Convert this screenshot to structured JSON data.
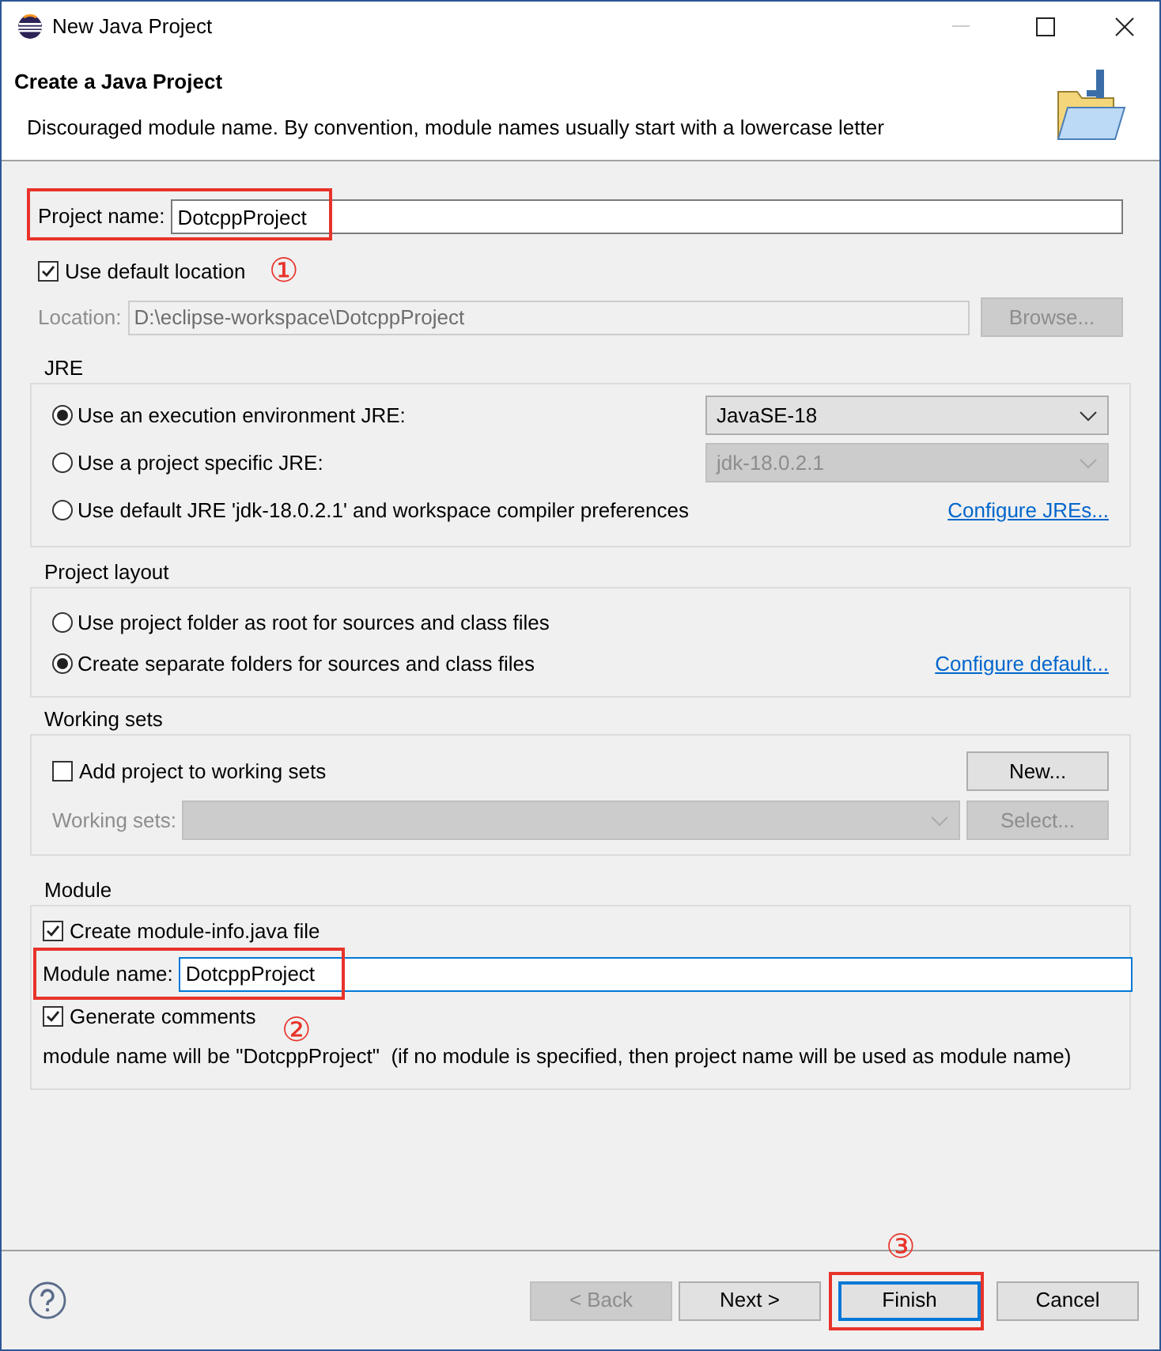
{
  "window": {
    "title": "New Java Project"
  },
  "header": {
    "title": "Create a Java Project",
    "message": "Discouraged module name. By convention, module names usually start with a lowercase letter"
  },
  "project_name": {
    "label": "Project name:",
    "value": "DotcppProject",
    "highlighted": true
  },
  "use_default_location": {
    "label": "Use default location",
    "checked": true,
    "marker": "①"
  },
  "location": {
    "label": "Location:",
    "value": "D:\\eclipse-workspace\\DotcppProject",
    "disabled": true,
    "button": {
      "label": "Browse...",
      "disabled": true
    }
  },
  "jre": {
    "title": "JRE",
    "options": [
      {
        "label": "Use an execution environment JRE:",
        "selected": true,
        "kind": "combo",
        "combo": {
          "value": "JavaSE-18",
          "disabled": false
        }
      },
      {
        "label": "Use a project specific JRE:",
        "selected": false,
        "kind": "combo",
        "combo": {
          "value": "jdk-18.0.2.1",
          "disabled": true
        }
      },
      {
        "label": "Use default JRE 'jdk-18.0.2.1' and workspace compiler preferences",
        "selected": false,
        "kind": "link",
        "link": "Configure JREs..."
      }
    ]
  },
  "project_layout": {
    "title": "Project layout",
    "options": [
      {
        "label": "Use project folder as root for sources and class files",
        "selected": false,
        "kind": "plain"
      },
      {
        "label": "Create separate folders for sources and class files",
        "selected": true,
        "kind": "link",
        "link": "Configure default..."
      }
    ]
  },
  "working_sets": {
    "title": "Working sets",
    "checkbox": {
      "label": "Add project to working sets",
      "checked": false
    },
    "new_button": {
      "label": "New...",
      "disabled": false
    },
    "field": {
      "label": "Working sets:",
      "disabled": true
    },
    "select_button": {
      "label": "Select...",
      "disabled": true
    }
  },
  "module": {
    "title": "Module",
    "create_module_info": {
      "label": "Create module-info.java file",
      "checked": true
    },
    "module_name": {
      "label": "Module name:",
      "value": "DotcppProject",
      "highlighted": true,
      "focused": true
    },
    "generate_comments": {
      "label": "Generate comments",
      "checked": true,
      "marker": "②"
    },
    "note": "module name will be \"DotcppProject\"  (if no module is specified, then project name will be used as module name)"
  },
  "buttons": [
    {
      "label": "< Back",
      "disabled": true,
      "default": false,
      "highlighted": false
    },
    {
      "label": "Next >",
      "disabled": false,
      "default": false,
      "highlighted": false
    },
    {
      "label": "Finish",
      "disabled": false,
      "default": true,
      "highlighted": true,
      "marker": "③"
    },
    {
      "label": "Cancel",
      "disabled": false,
      "default": false,
      "highlighted": false
    }
  ]
}
